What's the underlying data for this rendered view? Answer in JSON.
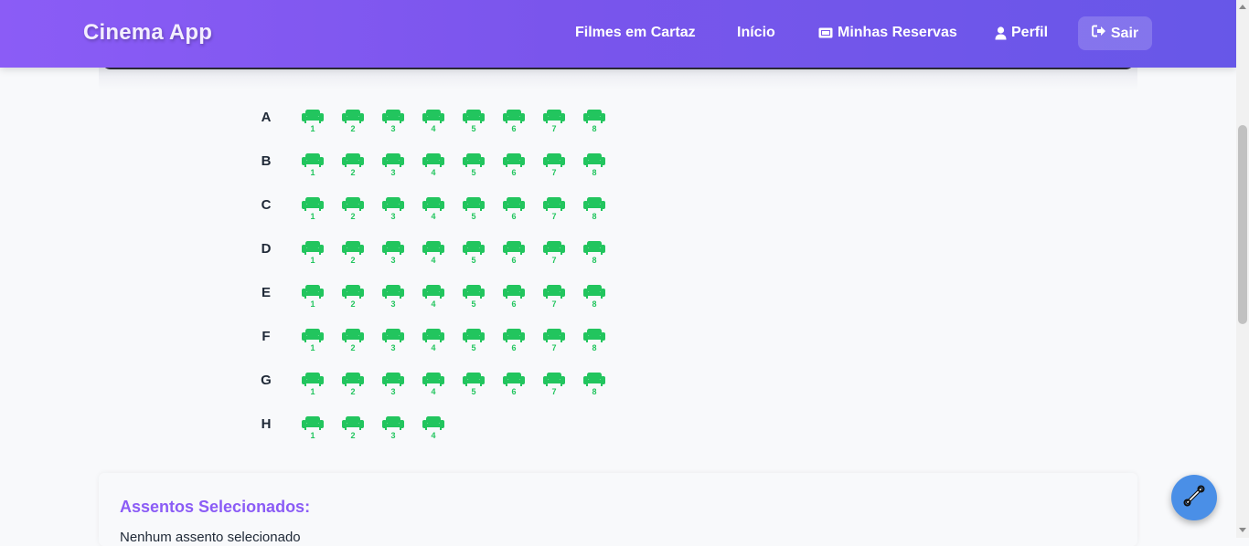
{
  "nav": {
    "brand": "Cinema App",
    "items": [
      {
        "label": "Filmes em Cartaz",
        "icon": null
      },
      {
        "label": "Início",
        "icon": null
      },
      {
        "label": "Minhas Reservas",
        "icon": "ticket-icon"
      },
      {
        "label": "Perfil",
        "icon": "user-icon"
      }
    ],
    "logout_label": "Sair",
    "logout_icon": "sign-out-icon"
  },
  "seat_map": {
    "available_color": "#22c55e",
    "rows": [
      {
        "label": "A",
        "seats": [
          "1",
          "2",
          "3",
          "4",
          "5",
          "6",
          "7",
          "8"
        ]
      },
      {
        "label": "B",
        "seats": [
          "1",
          "2",
          "3",
          "4",
          "5",
          "6",
          "7",
          "8"
        ]
      },
      {
        "label": "C",
        "seats": [
          "1",
          "2",
          "3",
          "4",
          "5",
          "6",
          "7",
          "8"
        ]
      },
      {
        "label": "D",
        "seats": [
          "1",
          "2",
          "3",
          "4",
          "5",
          "6",
          "7",
          "8"
        ]
      },
      {
        "label": "E",
        "seats": [
          "1",
          "2",
          "3",
          "4",
          "5",
          "6",
          "7",
          "8"
        ]
      },
      {
        "label": "F",
        "seats": [
          "1",
          "2",
          "3",
          "4",
          "5",
          "6",
          "7",
          "8"
        ]
      },
      {
        "label": "G",
        "seats": [
          "1",
          "2",
          "3",
          "4",
          "5",
          "6",
          "7",
          "8"
        ]
      },
      {
        "label": "H",
        "seats": [
          "1",
          "2",
          "3",
          "4"
        ]
      }
    ]
  },
  "selected": {
    "title": "Assentos Selecionados:",
    "empty_text": "Nenhum assento selecionado"
  },
  "colors": {
    "brand_gradient_start": "#8b5cf6",
    "brand_gradient_end": "#6757e8",
    "accent_purple": "#8b5cf6",
    "fab_blue": "#4a8fe7"
  },
  "fab": {
    "icon": "wrench-icon"
  }
}
